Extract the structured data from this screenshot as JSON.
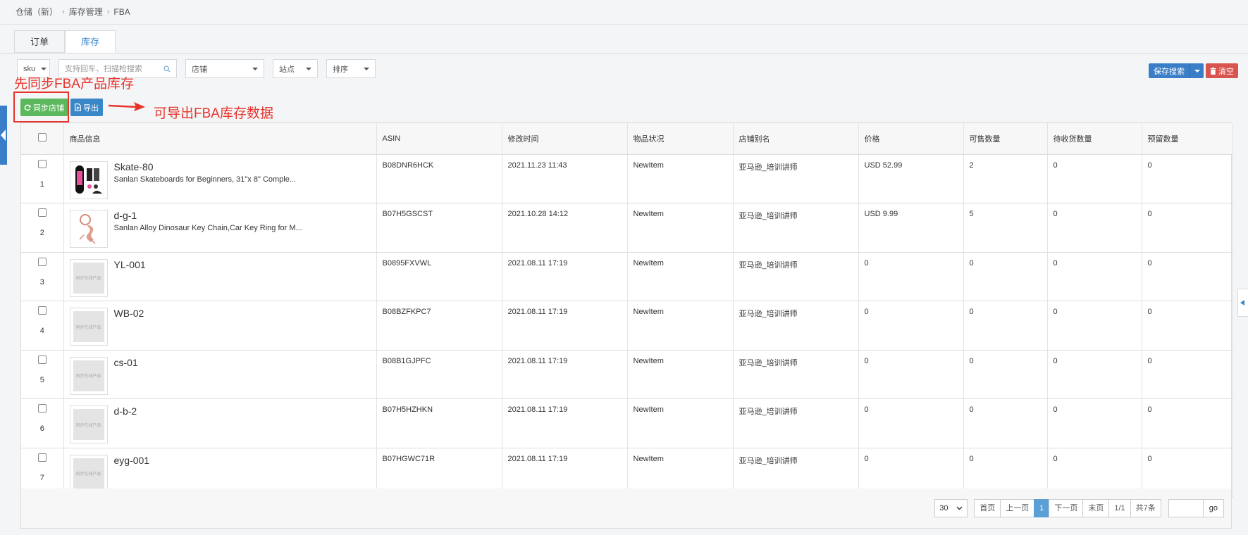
{
  "breadcrumb": [
    "仓储（新）",
    "库存管理",
    "FBA"
  ],
  "tabs": [
    {
      "label": "订单",
      "active": false
    },
    {
      "label": "库存",
      "active": true
    }
  ],
  "filters": {
    "sku_select": "sku",
    "search_placeholder": "支持回车、扫描枪搜索",
    "shop_select": "店铺",
    "site_select": "站点",
    "sort_select": "排序"
  },
  "buttons": {
    "save_search": "保存搜索",
    "clear": "清空",
    "sync": "同步店铺",
    "export": "导出"
  },
  "annotations": {
    "sync_note": "先同步FBA产品库存",
    "export_note": "可导出FBA库存数据"
  },
  "table": {
    "headers": [
      "商品信息",
      "ASIN",
      "修改时间",
      "物品状况",
      "店铺别名",
      "价格",
      "可售数量",
      "待收货数量",
      "预留数量"
    ],
    "placeholder_text": "同步在线产品",
    "rows": [
      {
        "num": "1",
        "sku": "Skate-80",
        "title": "Sanlan Skateboards for Beginners, 31\"x 8\" Comple...",
        "asin": "B08DNR6HCK",
        "time": "2021.11.23 11:43",
        "cond": "NewItem",
        "shop": "亚马逊_培训讲师",
        "price": "USD 52.99",
        "sell": "2",
        "pending": "0",
        "reserved": "0",
        "img": "skateboard"
      },
      {
        "num": "2",
        "sku": "d-g-1",
        "title": "Sanlan Alloy Dinosaur Key Chain,Car Key Ring for M...",
        "asin": "B07H5GSCST",
        "time": "2021.10.28 14:12",
        "cond": "NewItem",
        "shop": "亚马逊_培训讲师",
        "price": "USD 9.99",
        "sell": "5",
        "pending": "0",
        "reserved": "0",
        "img": "keychain"
      },
      {
        "num": "3",
        "sku": "YL-001",
        "title": "",
        "asin": "B0895FXVWL",
        "time": "2021.08.11 17:19",
        "cond": "NewItem",
        "shop": "亚马逊_培训讲师",
        "price": "0",
        "sell": "0",
        "pending": "0",
        "reserved": "0",
        "img": "placeholder"
      },
      {
        "num": "4",
        "sku": "WB-02",
        "title": "",
        "asin": "B08BZFKPC7",
        "time": "2021.08.11 17:19",
        "cond": "NewItem",
        "shop": "亚马逊_培训讲师",
        "price": "0",
        "sell": "0",
        "pending": "0",
        "reserved": "0",
        "img": "placeholder"
      },
      {
        "num": "5",
        "sku": "cs-01",
        "title": "",
        "asin": "B08B1GJPFC",
        "time": "2021.08.11 17:19",
        "cond": "NewItem",
        "shop": "亚马逊_培训讲师",
        "price": "0",
        "sell": "0",
        "pending": "0",
        "reserved": "0",
        "img": "placeholder"
      },
      {
        "num": "6",
        "sku": "d-b-2",
        "title": "",
        "asin": "B07H5HZHKN",
        "time": "2021.08.11 17:19",
        "cond": "NewItem",
        "shop": "亚马逊_培训讲师",
        "price": "0",
        "sell": "0",
        "pending": "0",
        "reserved": "0",
        "img": "placeholder"
      },
      {
        "num": "7",
        "sku": "eyg-001",
        "title": "",
        "asin": "B07HGWC71R",
        "time": "2021.08.11 17:19",
        "cond": "NewItem",
        "shop": "亚马逊_培训讲师",
        "price": "0",
        "sell": "0",
        "pending": "0",
        "reserved": "0",
        "img": "placeholder"
      }
    ]
  },
  "pager": {
    "page_size": "30",
    "first": "首页",
    "prev": "上一页",
    "current": "1",
    "next": "下一页",
    "last": "末页",
    "page_of": "1/1",
    "total": "共7条",
    "go": "go"
  },
  "colors": {
    "accent": "#3a87c8",
    "sync_green": "#5cb85c",
    "clear_red": "#d9534f",
    "annotation_red": "#e8332a"
  }
}
